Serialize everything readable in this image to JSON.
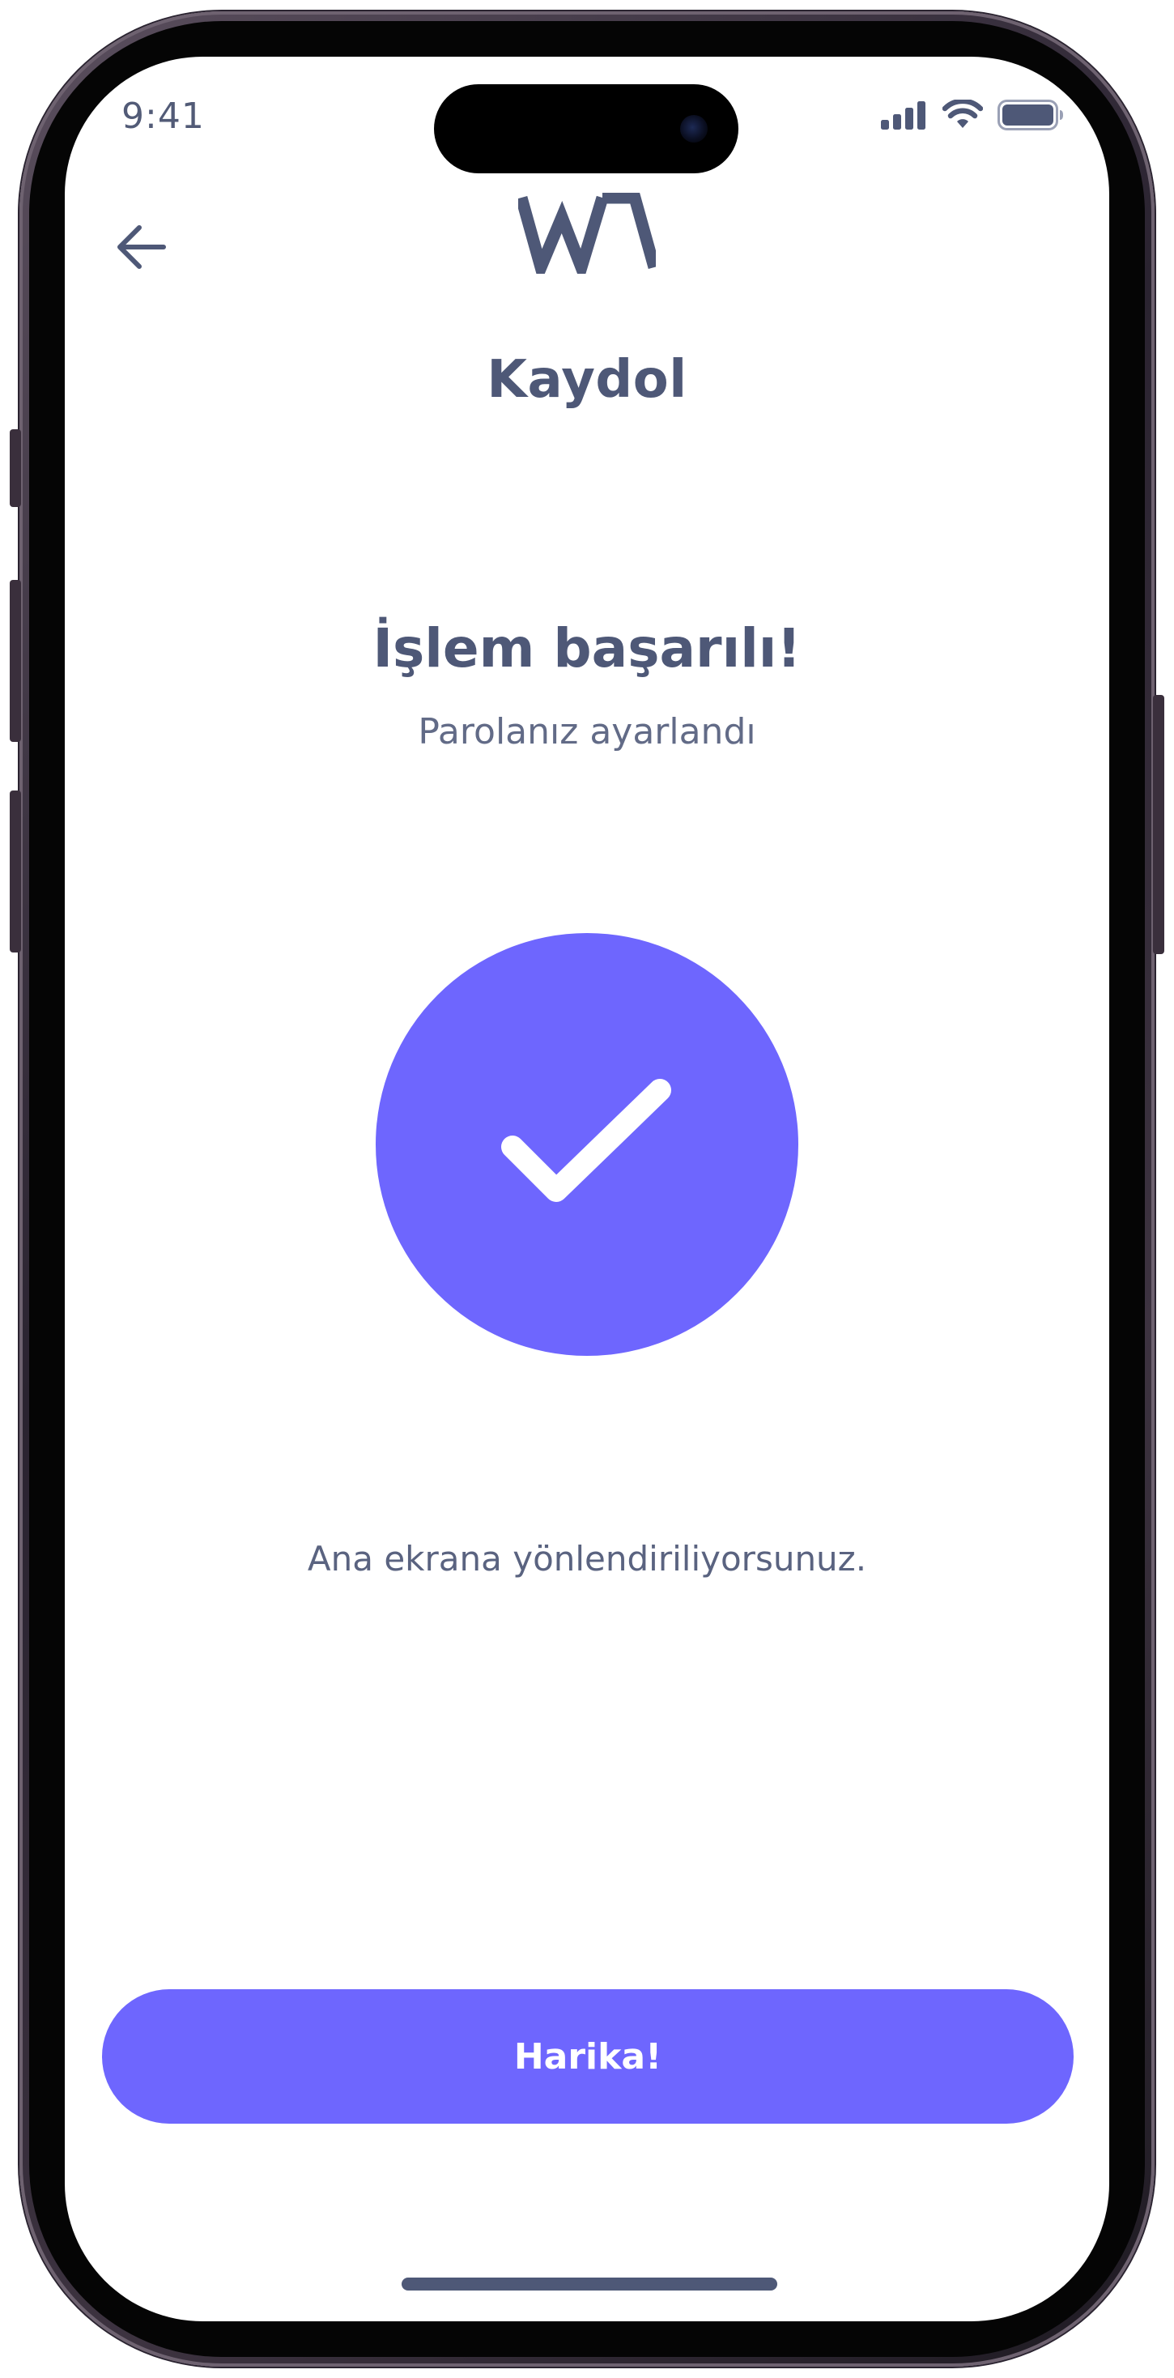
{
  "status_bar": {
    "time": "9:41",
    "signal_icon": "cellular-signal-icon",
    "wifi_icon": "wifi-icon",
    "battery_icon": "battery-icon"
  },
  "header": {
    "back_icon": "arrow-left-icon",
    "logo_text": "WA",
    "title": "Kaydol"
  },
  "success": {
    "heading": "İşlem başarılı!",
    "subtitle": "Parolanız ayarlandı",
    "icon": "checkmark-icon"
  },
  "redirect_message": "Ana ekrana yönlendiriliyorsunuz.",
  "primary_button": {
    "label": "Harika!"
  },
  "colors": {
    "accent": "#6e66fe",
    "text_primary": "#4e5877",
    "text_secondary": "#626b87",
    "background": "#ffffff"
  }
}
